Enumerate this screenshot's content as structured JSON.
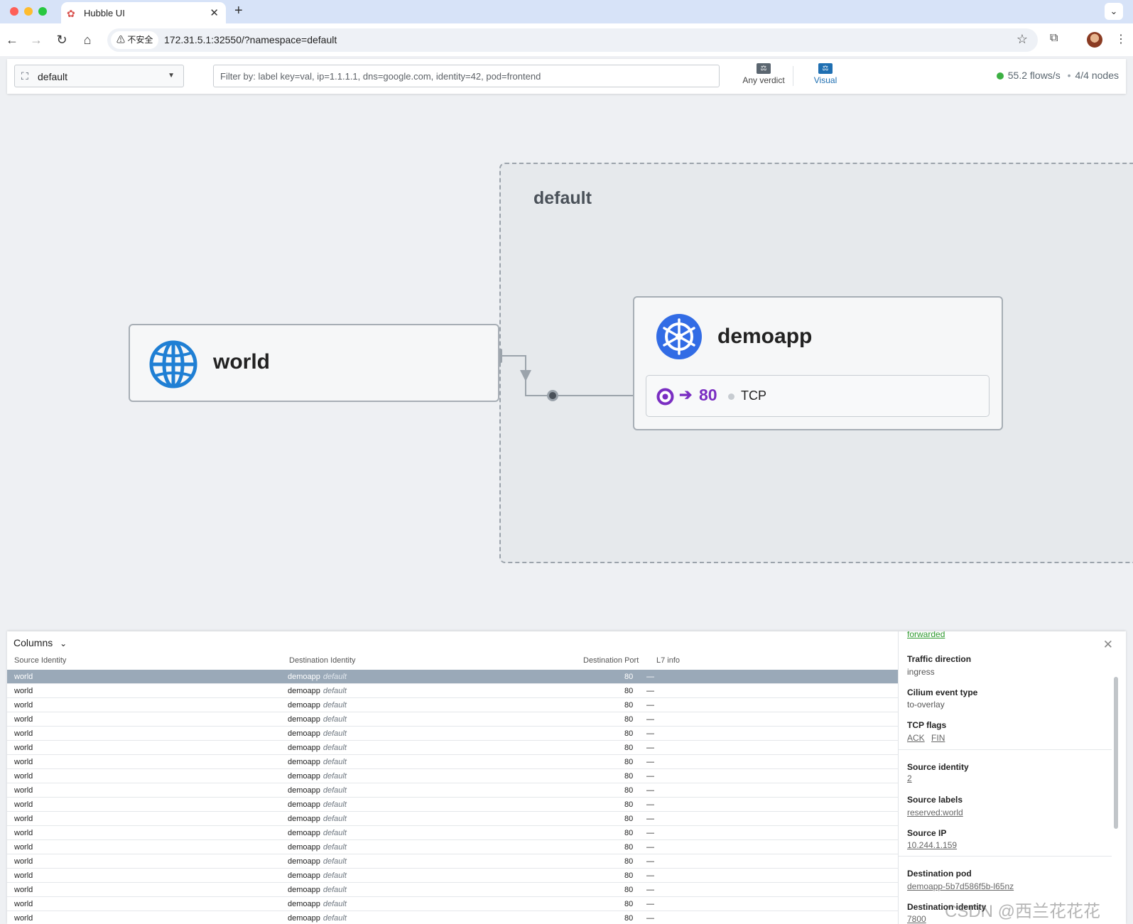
{
  "browser": {
    "tab_title": "Hubble UI",
    "new_tab_symbol": "+",
    "security_label": "不安全",
    "url": "172.31.5.1:32550/?namespace=default"
  },
  "header": {
    "namespace": "default",
    "filter_placeholder": "Filter by: label key=val, ip=1.1.1.1, dns=google.com, identity=42, pod=frontend",
    "verdict_label": "Any verdict",
    "visual_label": "Visual",
    "flow_rate": "55.2 flows/s",
    "separator": "•",
    "nodes": "4/4 nodes",
    "status_color": "#3cb043",
    "accent_color": "#1f6fb2"
  },
  "map": {
    "namespace_title": "default",
    "world_card": {
      "title": "world",
      "icon": "globe-icon"
    },
    "demoapp_card": {
      "title": "demoapp",
      "icon": "kubernetes-icon"
    },
    "port": {
      "number": "80",
      "protocol": "TCP",
      "arrow": "➔"
    }
  },
  "flows": {
    "columns_label": "Columns",
    "headers": {
      "source_identity": "Source Identity",
      "destination_identity": "Destination Identity",
      "destination_port": "Destination Port",
      "l7_info": "L7 info"
    },
    "rows": [
      {
        "source": "world",
        "dest": "demoapp",
        "dest_ns": "default",
        "port": "80",
        "l7": "—"
      },
      {
        "source": "world",
        "dest": "demoapp",
        "dest_ns": "default",
        "port": "80",
        "l7": "—"
      },
      {
        "source": "world",
        "dest": "demoapp",
        "dest_ns": "default",
        "port": "80",
        "l7": "—"
      },
      {
        "source": "world",
        "dest": "demoapp",
        "dest_ns": "default",
        "port": "80",
        "l7": "—"
      },
      {
        "source": "world",
        "dest": "demoapp",
        "dest_ns": "default",
        "port": "80",
        "l7": "—"
      },
      {
        "source": "world",
        "dest": "demoapp",
        "dest_ns": "default",
        "port": "80",
        "l7": "—"
      },
      {
        "source": "world",
        "dest": "demoapp",
        "dest_ns": "default",
        "port": "80",
        "l7": "—"
      },
      {
        "source": "world",
        "dest": "demoapp",
        "dest_ns": "default",
        "port": "80",
        "l7": "—"
      },
      {
        "source": "world",
        "dest": "demoapp",
        "dest_ns": "default",
        "port": "80",
        "l7": "—"
      },
      {
        "source": "world",
        "dest": "demoapp",
        "dest_ns": "default",
        "port": "80",
        "l7": "—"
      },
      {
        "source": "world",
        "dest": "demoapp",
        "dest_ns": "default",
        "port": "80",
        "l7": "—"
      },
      {
        "source": "world",
        "dest": "demoapp",
        "dest_ns": "default",
        "port": "80",
        "l7": "—"
      },
      {
        "source": "world",
        "dest": "demoapp",
        "dest_ns": "default",
        "port": "80",
        "l7": "—"
      },
      {
        "source": "world",
        "dest": "demoapp",
        "dest_ns": "default",
        "port": "80",
        "l7": "—"
      },
      {
        "source": "world",
        "dest": "demoapp",
        "dest_ns": "default",
        "port": "80",
        "l7": "—"
      },
      {
        "source": "world",
        "dest": "demoapp",
        "dest_ns": "default",
        "port": "80",
        "l7": "—"
      },
      {
        "source": "world",
        "dest": "demoapp",
        "dest_ns": "default",
        "port": "80",
        "l7": "—"
      },
      {
        "source": "world",
        "dest": "demoapp",
        "dest_ns": "default",
        "port": "80",
        "l7": "—"
      }
    ]
  },
  "details": {
    "verdict": "forwarded",
    "traffic_direction_label": "Traffic direction",
    "traffic_direction": "ingress",
    "event_type_label": "Cilium event type",
    "event_type": "to-overlay",
    "tcp_flags_label": "TCP flags",
    "tcp_flags": [
      "ACK",
      "FIN"
    ],
    "source_identity_label": "Source identity",
    "source_identity": "2",
    "source_labels_label": "Source labels",
    "source_labels": "reserved:world",
    "source_ip_label": "Source IP",
    "source_ip": "10.244.1.159",
    "destination_pod_label": "Destination pod",
    "destination_pod": "demoapp-5b7d586f5b-l65nz",
    "destination_identity_label": "Destination identity",
    "destination_identity": "7800"
  },
  "watermark": "CSDN @西兰花花花"
}
